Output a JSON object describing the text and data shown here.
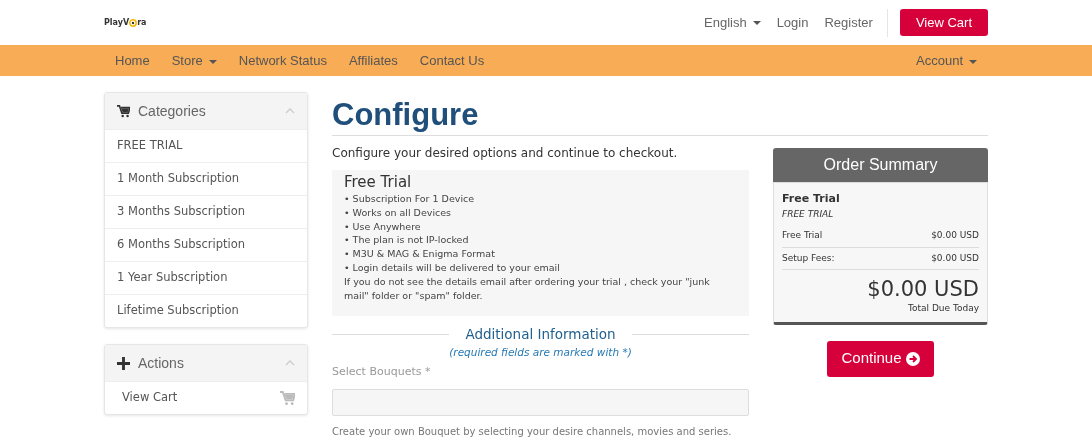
{
  "logo": {
    "parts": [
      "PlayV",
      "ra"
    ]
  },
  "top_links": [
    {
      "label": "English",
      "dropdown": true
    },
    {
      "label": "Login",
      "dropdown": false
    },
    {
      "label": "Register",
      "dropdown": false
    }
  ],
  "view_cart_button": "View Cart",
  "nav": {
    "left": [
      {
        "label": "Home",
        "dropdown": false
      },
      {
        "label": "Store",
        "dropdown": true
      },
      {
        "label": "Network Status",
        "dropdown": false
      },
      {
        "label": "Affiliates",
        "dropdown": false
      },
      {
        "label": "Contact Us",
        "dropdown": false
      }
    ],
    "right": [
      {
        "label": "Account",
        "dropdown": true
      }
    ]
  },
  "sidebar": {
    "panels": [
      {
        "title": "Categories",
        "kind": "categories",
        "items": [
          {
            "label": "FREE TRIAL"
          },
          {
            "label": "1 Month Subscription"
          },
          {
            "label": "3 Months Subscription"
          },
          {
            "label": "6 Months Subscription"
          },
          {
            "label": "1 Year Subscription"
          },
          {
            "label": "Lifetime Subscription"
          }
        ]
      },
      {
        "title": "Actions",
        "kind": "actions",
        "items": [
          {
            "label": "View Cart"
          }
        ]
      }
    ]
  },
  "page_title": "Configure",
  "intro": "Configure your desired options and continue to checkout.",
  "product": {
    "name": "Free Trial",
    "features": [
      "• Subscription For 1 Device",
      "• Works on all Devices",
      "• Use Anywhere",
      "• The plan is not IP-locked",
      "• M3U & MAG & Enigma Format",
      "• Login details will be delivered to your email"
    ],
    "note": "If you do not see the details email after ordering your trial , check your \"junk mail\" folder or \"spam\" folder."
  },
  "additional": {
    "title": "Additional Information",
    "subtitle": "(required fields are marked with *)",
    "field_label": "Select Bouquets *",
    "help": "Create your own Bouquet by selecting your desire channels, movies and series."
  },
  "summary": {
    "title": "Order Summary",
    "product": "Free Trial",
    "group": "FREE TRIAL",
    "lines": [
      {
        "label": "Free Trial",
        "amount": "$0.00 USD"
      },
      {
        "label": "Setup Fees:",
        "amount": "$0.00 USD"
      }
    ],
    "total": "$0.00 USD",
    "total_label": "Total Due Today"
  },
  "continue_button": "Continue"
}
